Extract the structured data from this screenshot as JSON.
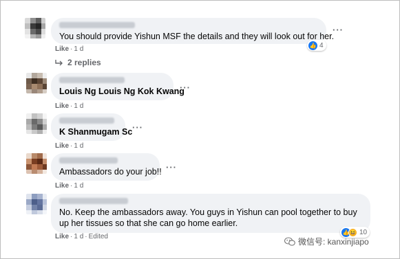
{
  "comments": [
    {
      "text": "You should provide Yishun MSF the details and they will look out for her.",
      "like": "Like",
      "time": "1 d",
      "edited": "",
      "reaction_count": "4",
      "reaction_icons": [
        "like-icon"
      ]
    },
    {
      "text": "Louis Ng Louis Ng Kok Kwang",
      "like": "Like",
      "time": "1 d",
      "edited": "",
      "reaction_count": ""
    },
    {
      "text": "K Shanmugam Sc",
      "like": "Like",
      "time": "1 d",
      "edited": "",
      "reaction_count": ""
    },
    {
      "text": "Ambassadors do your job!!",
      "like": "Like",
      "time": "1 d",
      "edited": "",
      "reaction_count": ""
    },
    {
      "text": "No. Keep the ambassadors away. You guys in Yishun can pool together to buy up her tissues so that she can go home earlier.",
      "like": "Like",
      "time": "1 d",
      "edited": "Edited",
      "reaction_count": "10",
      "reaction_icons": [
        "like-icon",
        "haha-icon"
      ]
    }
  ],
  "replies_label": "2 replies",
  "more_icon": "···",
  "watermark": "微信号: kanxinjiapo",
  "colors": {
    "bubble": "#f0f2f5",
    "meta": "#65676b",
    "like_blue": "#1877f2",
    "haha_yellow": "#f7b125"
  }
}
